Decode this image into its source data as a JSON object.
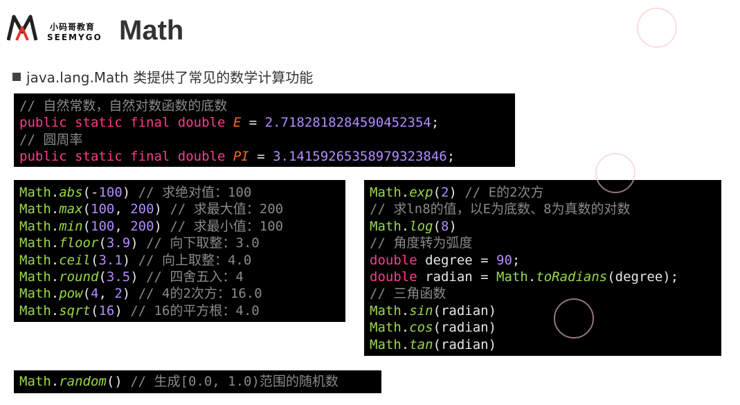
{
  "logo": {
    "cn": "小码哥教育",
    "en": "SEEMYGO"
  },
  "title": "Math",
  "subtitle": "java.lang.Math 类提供了常见的数学计算功能",
  "block1": [
    [
      {
        "t": "// 自然常数，自然对数函数的底数",
        "c": "cm"
      }
    ],
    [
      {
        "t": "public static final double ",
        "c": "kw"
      },
      {
        "t": "E",
        "c": "const"
      },
      {
        "t": " = ",
        "c": ""
      },
      {
        "t": "2.7182818284590452354",
        "c": "num"
      },
      {
        "t": ";",
        "c": ""
      }
    ],
    [
      {
        "t": "// 圆周率",
        "c": "cm"
      }
    ],
    [
      {
        "t": "public static final double ",
        "c": "kw"
      },
      {
        "t": "PI",
        "c": "const"
      },
      {
        "t": " = ",
        "c": ""
      },
      {
        "t": "3.14159265358979323846",
        "c": "num"
      },
      {
        "t": ";",
        "c": ""
      }
    ]
  ],
  "block2": [
    [
      {
        "t": "Math",
        "c": "cls"
      },
      {
        "t": ".",
        "c": ""
      },
      {
        "t": "abs",
        "c": "it"
      },
      {
        "t": "(-",
        "c": ""
      },
      {
        "t": "100",
        "c": "num"
      },
      {
        "t": ") ",
        "c": ""
      },
      {
        "t": "// 求绝对值：100",
        "c": "cm"
      }
    ],
    [
      {
        "t": "Math",
        "c": "cls"
      },
      {
        "t": ".",
        "c": ""
      },
      {
        "t": "max",
        "c": "it"
      },
      {
        "t": "(",
        "c": ""
      },
      {
        "t": "100",
        "c": "num"
      },
      {
        "t": ", ",
        "c": ""
      },
      {
        "t": "200",
        "c": "num"
      },
      {
        "t": ") ",
        "c": ""
      },
      {
        "t": "// 求最大值：200",
        "c": "cm"
      }
    ],
    [
      {
        "t": "Math",
        "c": "cls"
      },
      {
        "t": ".",
        "c": ""
      },
      {
        "t": "min",
        "c": "it"
      },
      {
        "t": "(",
        "c": ""
      },
      {
        "t": "100",
        "c": "num"
      },
      {
        "t": ", ",
        "c": ""
      },
      {
        "t": "200",
        "c": "num"
      },
      {
        "t": ") ",
        "c": ""
      },
      {
        "t": "// 求最小值：100",
        "c": "cm"
      }
    ],
    [
      {
        "t": "Math",
        "c": "cls"
      },
      {
        "t": ".",
        "c": ""
      },
      {
        "t": "floor",
        "c": "it"
      },
      {
        "t": "(",
        "c": ""
      },
      {
        "t": "3.9",
        "c": "num"
      },
      {
        "t": ") ",
        "c": ""
      },
      {
        "t": "// 向下取整：3.0",
        "c": "cm"
      }
    ],
    [
      {
        "t": "Math",
        "c": "cls"
      },
      {
        "t": ".",
        "c": ""
      },
      {
        "t": "ceil",
        "c": "it"
      },
      {
        "t": "(",
        "c": ""
      },
      {
        "t": "3.1",
        "c": "num"
      },
      {
        "t": ") ",
        "c": ""
      },
      {
        "t": "// 向上取整：4.0",
        "c": "cm"
      }
    ],
    [
      {
        "t": "Math",
        "c": "cls"
      },
      {
        "t": ".",
        "c": ""
      },
      {
        "t": "round",
        "c": "it"
      },
      {
        "t": "(",
        "c": ""
      },
      {
        "t": "3.5",
        "c": "num"
      },
      {
        "t": ") ",
        "c": ""
      },
      {
        "t": "// 四舍五入：4",
        "c": "cm"
      }
    ],
    [
      {
        "t": "Math",
        "c": "cls"
      },
      {
        "t": ".",
        "c": ""
      },
      {
        "t": "pow",
        "c": "it"
      },
      {
        "t": "(",
        "c": ""
      },
      {
        "t": "4",
        "c": "num"
      },
      {
        "t": ", ",
        "c": ""
      },
      {
        "t": "2",
        "c": "num"
      },
      {
        "t": ") ",
        "c": ""
      },
      {
        "t": "// 4的2次方：16.0",
        "c": "cm"
      }
    ],
    [
      {
        "t": "Math",
        "c": "cls"
      },
      {
        "t": ".",
        "c": ""
      },
      {
        "t": "sqrt",
        "c": "it"
      },
      {
        "t": "(",
        "c": ""
      },
      {
        "t": "16",
        "c": "num"
      },
      {
        "t": ") ",
        "c": ""
      },
      {
        "t": "// 16的平方根：4.0",
        "c": "cm"
      }
    ]
  ],
  "block3": [
    [
      {
        "t": "Math",
        "c": "cls"
      },
      {
        "t": ".",
        "c": ""
      },
      {
        "t": "exp",
        "c": "it"
      },
      {
        "t": "(",
        "c": ""
      },
      {
        "t": "2",
        "c": "num"
      },
      {
        "t": ") ",
        "c": ""
      },
      {
        "t": "// E的2次方",
        "c": "cm"
      }
    ],
    [
      {
        "t": "// 求ln8的值，以E为底数、8为真数的对数",
        "c": "cm"
      }
    ],
    [
      {
        "t": "Math",
        "c": "cls"
      },
      {
        "t": ".",
        "c": ""
      },
      {
        "t": "log",
        "c": "it"
      },
      {
        "t": "(",
        "c": ""
      },
      {
        "t": "8",
        "c": "num"
      },
      {
        "t": ")",
        "c": ""
      }
    ],
    [
      {
        "t": "// 角度转为弧度",
        "c": "cm"
      }
    ],
    [
      {
        "t": "double",
        "c": "kw"
      },
      {
        "t": " degree = ",
        "c": ""
      },
      {
        "t": "90",
        "c": "num"
      },
      {
        "t": ";",
        "c": ""
      }
    ],
    [
      {
        "t": "double",
        "c": "kw"
      },
      {
        "t": " radian = ",
        "c": ""
      },
      {
        "t": "Math",
        "c": "cls"
      },
      {
        "t": ".",
        "c": ""
      },
      {
        "t": "toRadians",
        "c": "it"
      },
      {
        "t": "(degree);",
        "c": ""
      }
    ],
    [
      {
        "t": "// 三角函数",
        "c": "cm"
      }
    ],
    [
      {
        "t": "Math",
        "c": "cls"
      },
      {
        "t": ".",
        "c": ""
      },
      {
        "t": "sin",
        "c": "it"
      },
      {
        "t": "(radian)",
        "c": ""
      }
    ],
    [
      {
        "t": "Math",
        "c": "cls"
      },
      {
        "t": ".",
        "c": ""
      },
      {
        "t": "cos",
        "c": "it"
      },
      {
        "t": "(radian)",
        "c": ""
      }
    ],
    [
      {
        "t": "Math",
        "c": "cls"
      },
      {
        "t": ".",
        "c": ""
      },
      {
        "t": "tan",
        "c": "it"
      },
      {
        "t": "(radian)",
        "c": ""
      }
    ]
  ],
  "block4": [
    [
      {
        "t": "Math",
        "c": "cls"
      },
      {
        "t": ".",
        "c": ""
      },
      {
        "t": "random",
        "c": "it"
      },
      {
        "t": "() ",
        "c": ""
      },
      {
        "t": "// 生成[0.0, 1.0)范围的随机数",
        "c": "cm"
      }
    ]
  ]
}
